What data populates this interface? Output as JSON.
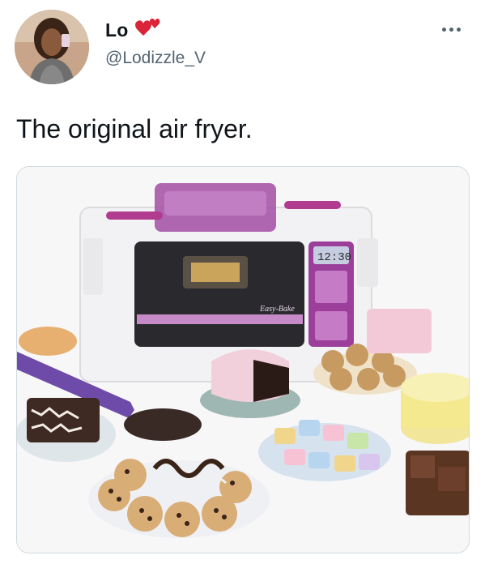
{
  "user": {
    "display_name": "Lo",
    "handle": "@Lodizzle_V",
    "badge_icon": "heart-icon"
  },
  "header": {
    "more_icon": "more-icon"
  },
  "tweet": {
    "text": "The original air fryer."
  },
  "media": {
    "oven_brand": "Easy-Bake",
    "clock_time": "12:30"
  },
  "colors": {
    "text_primary": "#0f1419",
    "text_secondary": "#536471",
    "heart": "#d9243a",
    "oven_purple": "#8b3f8f",
    "border": "#cfd9de"
  }
}
